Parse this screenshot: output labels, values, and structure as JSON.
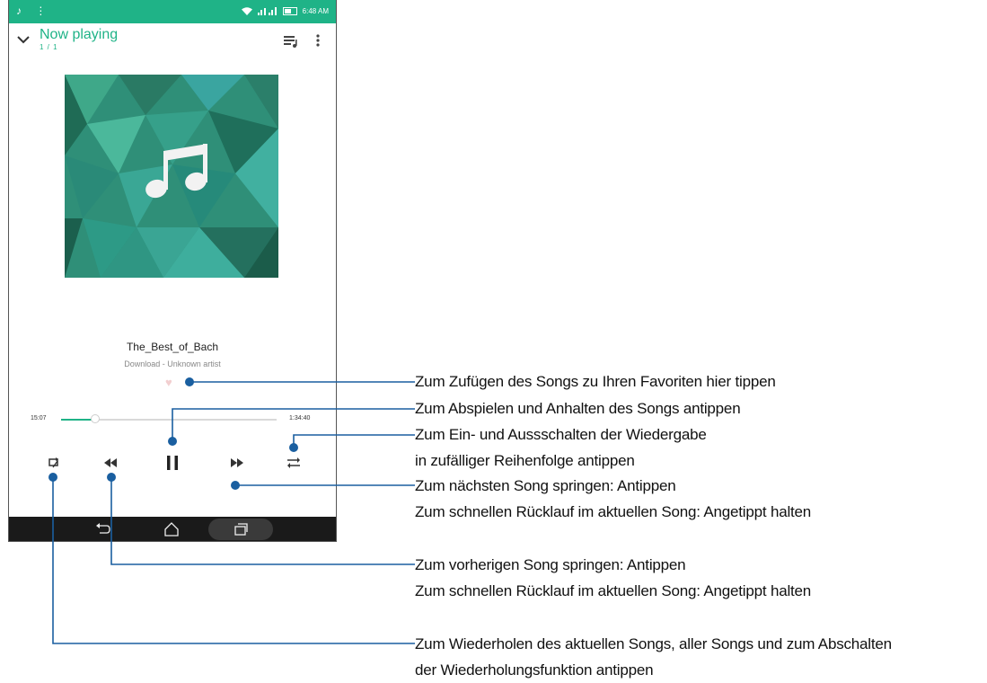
{
  "status_bar": {
    "time": "6:48 AM",
    "colors": {
      "accent": "#1fb387"
    }
  },
  "header": {
    "title": "Now playing",
    "track_count": "1 / 1"
  },
  "album": {
    "art": "music-note-polygon-artwork"
  },
  "song": {
    "title": "The_Best_of_Bach",
    "subtitle": "Download - Unknown artist"
  },
  "progress": {
    "elapsed": "15:07",
    "total": "1:34:40",
    "fraction": 0.16
  },
  "controls": {
    "repeat": "repeat-icon",
    "previous": "rewind-icon",
    "play_pause": "pause-icon",
    "next": "fast-forward-icon",
    "shuffle": "shuffle-icon"
  },
  "annotations": [
    {
      "lines": [
        "Zum Zufügen des Songs zu Ihren Favoriten hier tippen"
      ]
    },
    {
      "lines": [
        "Zum Abspielen und Anhalten des Songs antippen"
      ]
    },
    {
      "lines": [
        "Zum Ein- und Aussschalten der Wiedergabe",
        "in zufälliger Reihenfolge antippen"
      ]
    },
    {
      "lines": [
        "Zum nächsten Song springen: Antippen",
        "Zum schnellen Rücklauf im aktuellen Song: Angetippt halten"
      ]
    },
    {
      "lines": [
        "Zum vorherigen Song springen: Antippen",
        "Zum schnellen Rücklauf im aktuellen Song: Angetippt halten"
      ]
    },
    {
      "lines": [
        "Zum Wiederholen des aktuellen Songs, aller Songs und zum Abschalten",
        "der Wiederholungsfunktion antippen"
      ]
    }
  ]
}
